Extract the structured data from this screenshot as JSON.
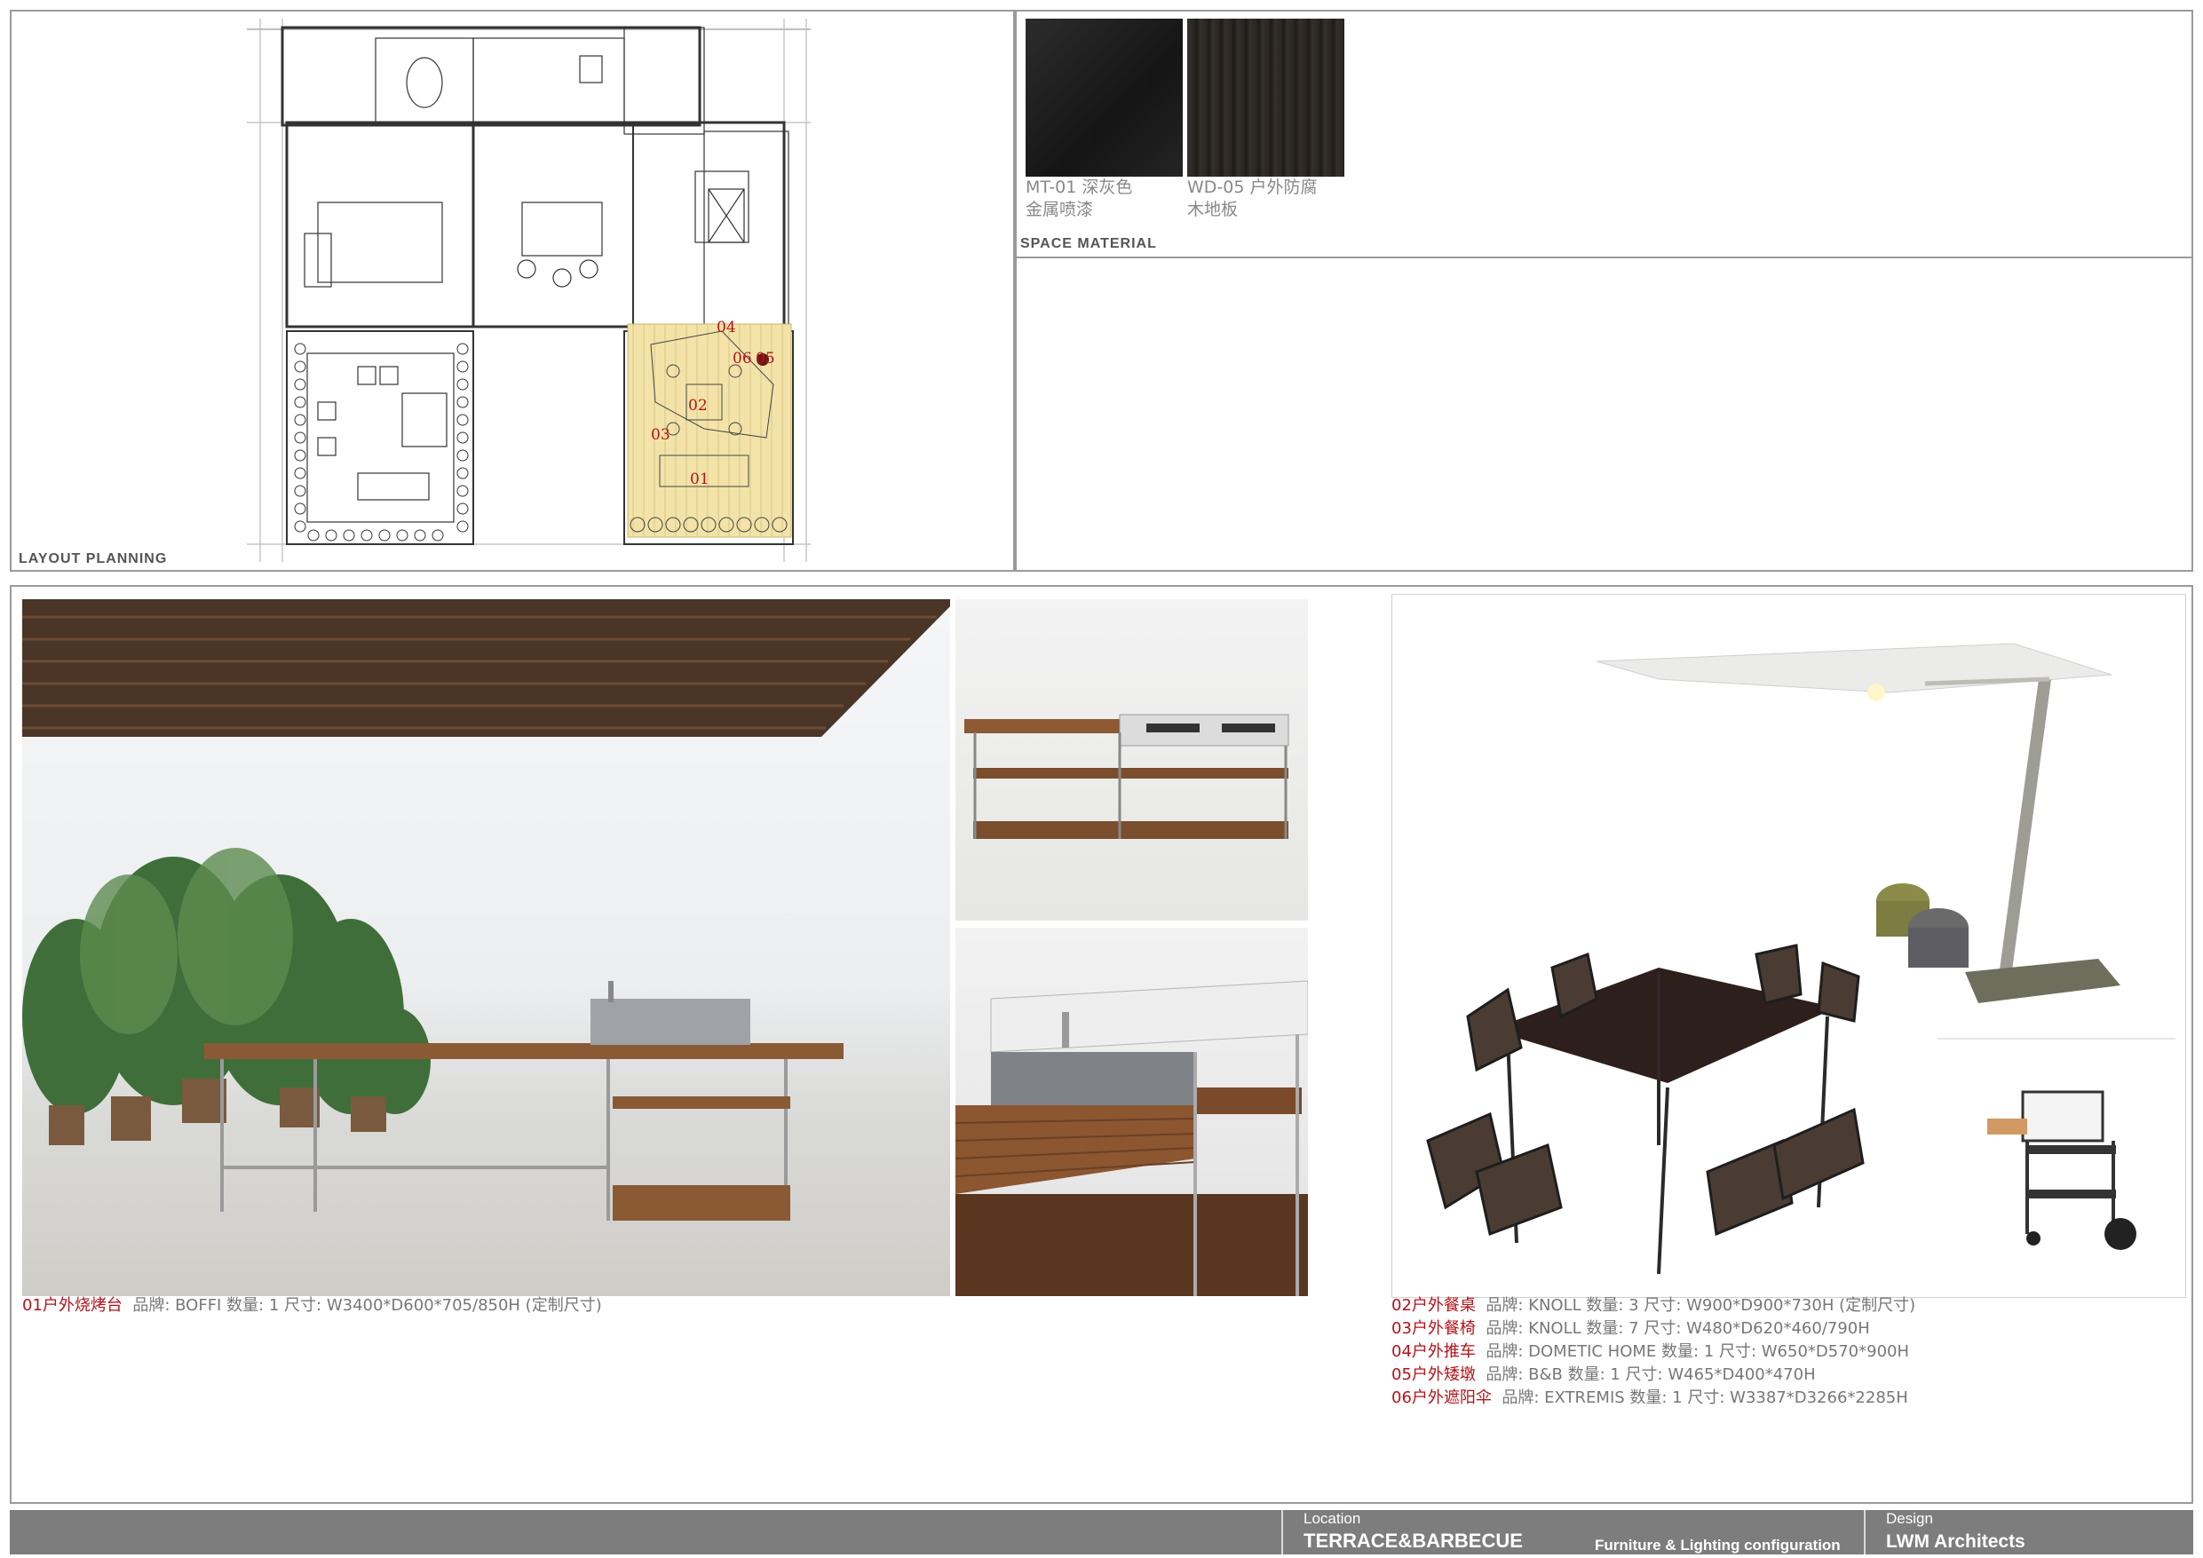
{
  "sections": {
    "layout_label": "LAYOUT  PLANNING",
    "material_label": "SPACE  MATERIAL"
  },
  "plan": {
    "markers": [
      "04",
      "06",
      "05",
      "02",
      "03",
      "01"
    ],
    "highlight_color": "#f3e3a8"
  },
  "materials": [
    {
      "code_line1": "MT-01 深灰色",
      "code_line2": "金属喷漆",
      "color": "#1f1f1f"
    },
    {
      "code_line1": "WD-05 户外防腐",
      "code_line2": "木地板",
      "color": "#2b2723"
    }
  ],
  "specs": {
    "s01": {
      "label": "01户外烧烤台",
      "detail": "品牌: BOFFI  数量: 1  尺寸: W3400*D600*705/850H (定制尺寸)"
    },
    "s02": {
      "label": "02户外餐桌",
      "detail": "品牌: KNOLL  数量: 3  尺寸: W900*D900*730H (定制尺寸)"
    },
    "s03": {
      "label": "03户外餐椅",
      "detail": "品牌: KNOLL  数量: 7  尺寸: W480*D620*460/790H"
    },
    "s04": {
      "label": "04户外推车",
      "detail": "品牌: DOMETIC HOME  数量: 1  尺寸: W650*D570*900H"
    },
    "s05": {
      "label": "05户外矮墩",
      "detail": "品牌: B&B  数量: 1  尺寸: W465*D400*470H"
    },
    "s06": {
      "label": "06户外遮阳伞",
      "detail": "品牌: EXTREMIS  数量: 1  尺寸: W3387*D3266*2285H"
    }
  },
  "title_block": {
    "location_label": "Location",
    "location_value": "TERRACE&BARBECUE",
    "subtitle": "Furniture & Lighting configuration",
    "design_label": "Design",
    "design_value": "LWM  Architects",
    "bar_color": "#7d7d7d"
  }
}
